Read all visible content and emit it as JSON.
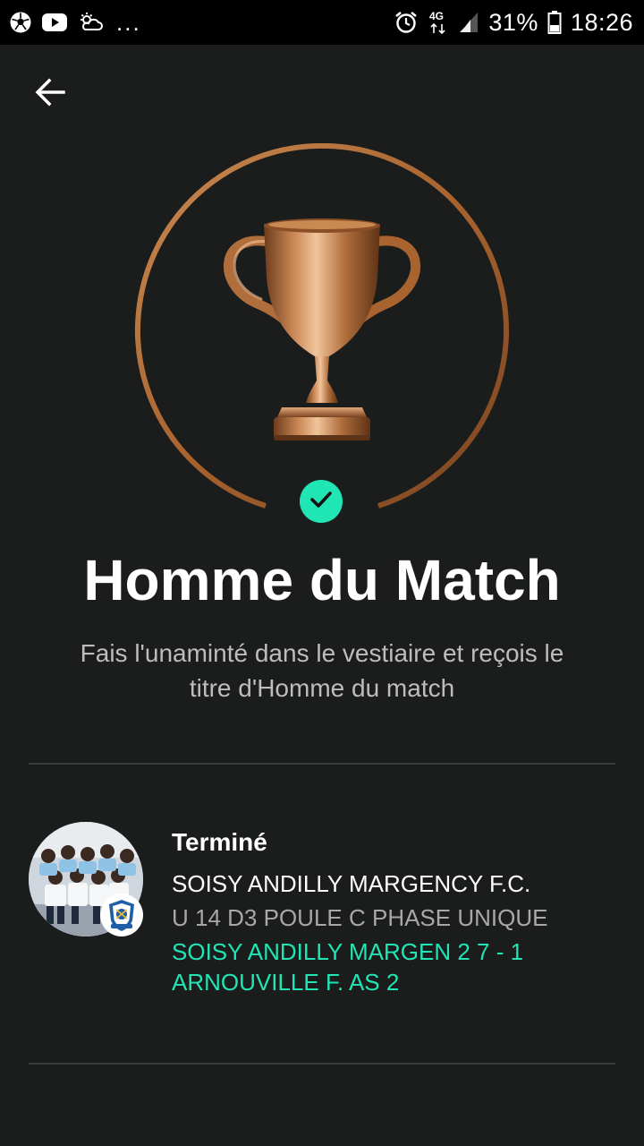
{
  "status_bar": {
    "time": "18:26",
    "battery_percent": "31%",
    "network": "4G",
    "overflow": "...",
    "left_icons": [
      "soccer-ball-icon",
      "youtube-icon",
      "weather-icon"
    ],
    "right_icons": [
      "alarm-icon",
      "network-4g-icon",
      "signal-icon",
      "battery-icon"
    ]
  },
  "header": {
    "back_icon": "arrow-left-icon"
  },
  "hero": {
    "trophy_icon": "trophy-icon",
    "ring_color": "#b87333",
    "check_color": "#1fe6b4"
  },
  "title": "Homme du Match",
  "subtitle_line1": "Fais l'unaminté dans le vestiaire et reçois le",
  "subtitle_line2": "titre d'Homme du match",
  "match": {
    "status": "Terminé",
    "club": "SOISY ANDILLY MARGENCY F.C.",
    "competition": "U 14 D3 POULE C PHASE UNIQUE",
    "score_line1": "SOISY ANDILLY MARGEN 2 7 - 1",
    "score_line2": "ARNOUVILLE F. AS 2",
    "accent_color": "#1fe6b4"
  }
}
